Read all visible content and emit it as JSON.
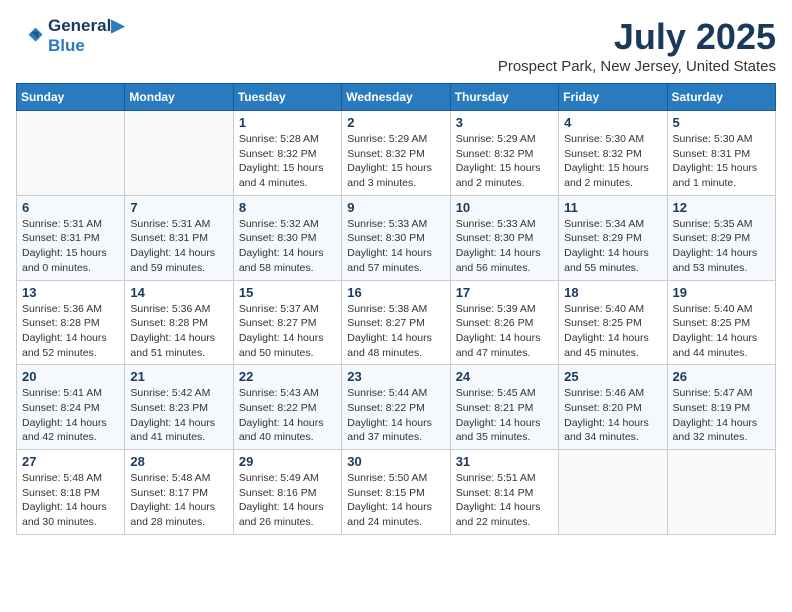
{
  "logo": {
    "line1": "General",
    "line2": "Blue"
  },
  "title": "July 2025",
  "location": "Prospect Park, New Jersey, United States",
  "weekdays": [
    "Sunday",
    "Monday",
    "Tuesday",
    "Wednesday",
    "Thursday",
    "Friday",
    "Saturday"
  ],
  "weeks": [
    [
      {
        "day": "",
        "info": ""
      },
      {
        "day": "",
        "info": ""
      },
      {
        "day": "1",
        "info": "Sunrise: 5:28 AM\nSunset: 8:32 PM\nDaylight: 15 hours\nand 4 minutes."
      },
      {
        "day": "2",
        "info": "Sunrise: 5:29 AM\nSunset: 8:32 PM\nDaylight: 15 hours\nand 3 minutes."
      },
      {
        "day": "3",
        "info": "Sunrise: 5:29 AM\nSunset: 8:32 PM\nDaylight: 15 hours\nand 2 minutes."
      },
      {
        "day": "4",
        "info": "Sunrise: 5:30 AM\nSunset: 8:32 PM\nDaylight: 15 hours\nand 2 minutes."
      },
      {
        "day": "5",
        "info": "Sunrise: 5:30 AM\nSunset: 8:31 PM\nDaylight: 15 hours\nand 1 minute."
      }
    ],
    [
      {
        "day": "6",
        "info": "Sunrise: 5:31 AM\nSunset: 8:31 PM\nDaylight: 15 hours\nand 0 minutes."
      },
      {
        "day": "7",
        "info": "Sunrise: 5:31 AM\nSunset: 8:31 PM\nDaylight: 14 hours\nand 59 minutes."
      },
      {
        "day": "8",
        "info": "Sunrise: 5:32 AM\nSunset: 8:30 PM\nDaylight: 14 hours\nand 58 minutes."
      },
      {
        "day": "9",
        "info": "Sunrise: 5:33 AM\nSunset: 8:30 PM\nDaylight: 14 hours\nand 57 minutes."
      },
      {
        "day": "10",
        "info": "Sunrise: 5:33 AM\nSunset: 8:30 PM\nDaylight: 14 hours\nand 56 minutes."
      },
      {
        "day": "11",
        "info": "Sunrise: 5:34 AM\nSunset: 8:29 PM\nDaylight: 14 hours\nand 55 minutes."
      },
      {
        "day": "12",
        "info": "Sunrise: 5:35 AM\nSunset: 8:29 PM\nDaylight: 14 hours\nand 53 minutes."
      }
    ],
    [
      {
        "day": "13",
        "info": "Sunrise: 5:36 AM\nSunset: 8:28 PM\nDaylight: 14 hours\nand 52 minutes."
      },
      {
        "day": "14",
        "info": "Sunrise: 5:36 AM\nSunset: 8:28 PM\nDaylight: 14 hours\nand 51 minutes."
      },
      {
        "day": "15",
        "info": "Sunrise: 5:37 AM\nSunset: 8:27 PM\nDaylight: 14 hours\nand 50 minutes."
      },
      {
        "day": "16",
        "info": "Sunrise: 5:38 AM\nSunset: 8:27 PM\nDaylight: 14 hours\nand 48 minutes."
      },
      {
        "day": "17",
        "info": "Sunrise: 5:39 AM\nSunset: 8:26 PM\nDaylight: 14 hours\nand 47 minutes."
      },
      {
        "day": "18",
        "info": "Sunrise: 5:40 AM\nSunset: 8:25 PM\nDaylight: 14 hours\nand 45 minutes."
      },
      {
        "day": "19",
        "info": "Sunrise: 5:40 AM\nSunset: 8:25 PM\nDaylight: 14 hours\nand 44 minutes."
      }
    ],
    [
      {
        "day": "20",
        "info": "Sunrise: 5:41 AM\nSunset: 8:24 PM\nDaylight: 14 hours\nand 42 minutes."
      },
      {
        "day": "21",
        "info": "Sunrise: 5:42 AM\nSunset: 8:23 PM\nDaylight: 14 hours\nand 41 minutes."
      },
      {
        "day": "22",
        "info": "Sunrise: 5:43 AM\nSunset: 8:22 PM\nDaylight: 14 hours\nand 40 minutes."
      },
      {
        "day": "23",
        "info": "Sunrise: 5:44 AM\nSunset: 8:22 PM\nDaylight: 14 hours\nand 37 minutes."
      },
      {
        "day": "24",
        "info": "Sunrise: 5:45 AM\nSunset: 8:21 PM\nDaylight: 14 hours\nand 35 minutes."
      },
      {
        "day": "25",
        "info": "Sunrise: 5:46 AM\nSunset: 8:20 PM\nDaylight: 14 hours\nand 34 minutes."
      },
      {
        "day": "26",
        "info": "Sunrise: 5:47 AM\nSunset: 8:19 PM\nDaylight: 14 hours\nand 32 minutes."
      }
    ],
    [
      {
        "day": "27",
        "info": "Sunrise: 5:48 AM\nSunset: 8:18 PM\nDaylight: 14 hours\nand 30 minutes."
      },
      {
        "day": "28",
        "info": "Sunrise: 5:48 AM\nSunset: 8:17 PM\nDaylight: 14 hours\nand 28 minutes."
      },
      {
        "day": "29",
        "info": "Sunrise: 5:49 AM\nSunset: 8:16 PM\nDaylight: 14 hours\nand 26 minutes."
      },
      {
        "day": "30",
        "info": "Sunrise: 5:50 AM\nSunset: 8:15 PM\nDaylight: 14 hours\nand 24 minutes."
      },
      {
        "day": "31",
        "info": "Sunrise: 5:51 AM\nSunset: 8:14 PM\nDaylight: 14 hours\nand 22 minutes."
      },
      {
        "day": "",
        "info": ""
      },
      {
        "day": "",
        "info": ""
      }
    ]
  ]
}
